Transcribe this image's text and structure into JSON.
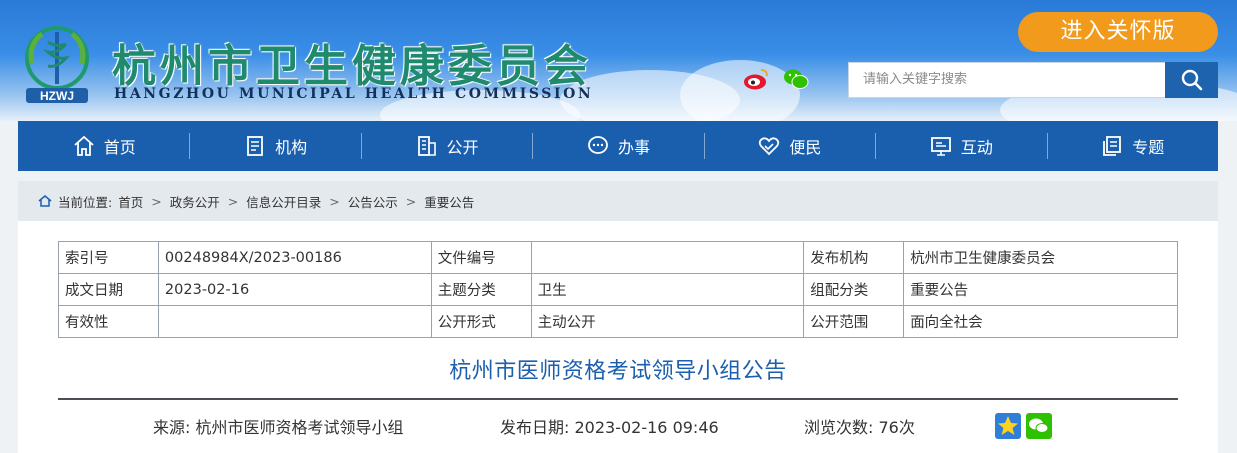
{
  "header": {
    "logo_text": "HZWJ",
    "title": "杭州市卫生健康委员会",
    "subtitle": "HANGZHOU MUNICIPAL HEALTH COMMISSION",
    "care_button": "进入关怀版",
    "social_icons": [
      "weibo-icon",
      "wechat-icon"
    ],
    "search": {
      "placeholder": "请输入关键字搜索",
      "button_icon": "search-icon"
    }
  },
  "nav": {
    "items": [
      {
        "label": "首页",
        "icon": "home-icon"
      },
      {
        "label": "机构",
        "icon": "building-doc-icon"
      },
      {
        "label": "公开",
        "icon": "office-building-icon"
      },
      {
        "label": "办事",
        "icon": "chat-bubble-icon"
      },
      {
        "label": "便民",
        "icon": "heart-hand-icon"
      },
      {
        "label": "互动",
        "icon": "monitor-icon"
      },
      {
        "label": "专题",
        "icon": "documents-icon"
      }
    ]
  },
  "breadcrumb": {
    "prefix": "当前位置:",
    "items": [
      "首页",
      "政务公开",
      "信息公开目录",
      "公告公示",
      "重要公告"
    ],
    "separator": ">"
  },
  "meta_table": {
    "rows": [
      [
        "索引号",
        "00248984X/2023-00186",
        "文件编号",
        "",
        "发布机构",
        "杭州市卫生健康委员会"
      ],
      [
        "成文日期",
        "2023-02-16",
        "主题分类",
        "卫生",
        "组配分类",
        "重要公告"
      ],
      [
        "有效性",
        "",
        "公开形式",
        "主动公开",
        "公开范围",
        "面向全社会"
      ]
    ]
  },
  "article": {
    "title": "杭州市医师资格考试领导小组公告",
    "source_label": "来源:",
    "source": "杭州市医师资格考试领导小组",
    "date_label": "发布日期:",
    "date": "2023-02-16 09:46",
    "views_label": "浏览次数:",
    "views": "76次",
    "share_icons": [
      "favorite-star-icon",
      "wechat-share-icon"
    ]
  },
  "colors": {
    "nav_bg": "#1a5fae",
    "title_green": "#1f8a6d",
    "care_orange": "#f29a1b",
    "doc_title_blue": "#1b5fae"
  }
}
